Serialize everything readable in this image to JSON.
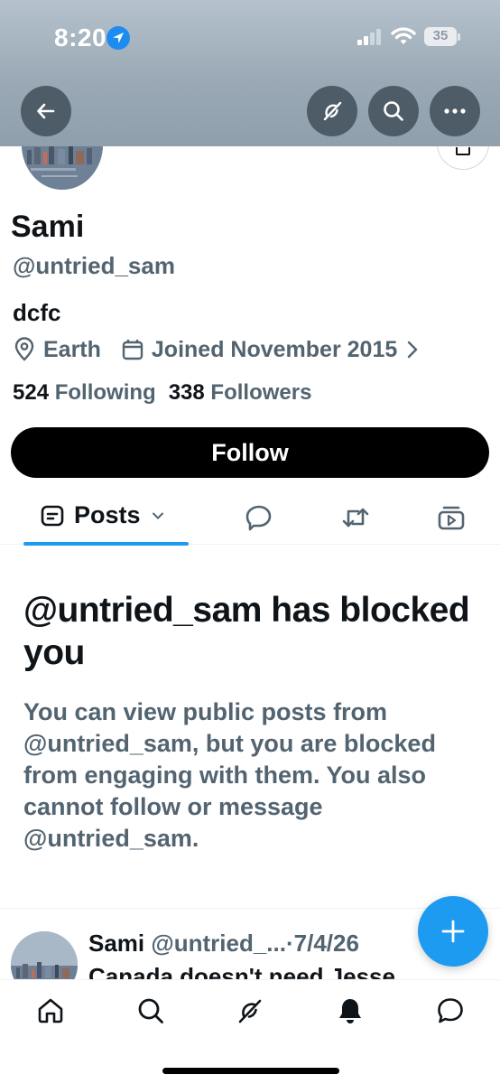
{
  "status_bar": {
    "time": "8:20",
    "battery": "35"
  },
  "header": {
    "back_icon": "arrow-left-icon",
    "grok_icon": "grok-icon",
    "search_icon": "search-icon",
    "more_icon": "more-horizontal-icon"
  },
  "profile": {
    "name": "Sami",
    "handle": "@untried_sam",
    "bio": "dcfc",
    "location": "Earth",
    "joined": "Joined November 2015",
    "following_count": "524",
    "following_label": "Following",
    "followers_count": "338",
    "followers_label": "Followers",
    "follow_label": "Follow"
  },
  "tabs": {
    "posts_label": "Posts",
    "reply_icon": "reply-icon",
    "retweet_icon": "retweet-icon",
    "media_icon": "media-icon"
  },
  "blocked": {
    "title": "@untried_sam has blocked you",
    "body": "You can view public posts from @untried_sam, but you are blocked from engaging with them. You also cannot follow or message @untried_sam."
  },
  "tweet": {
    "name": "Sami",
    "handle": "@untried_...",
    "separator": "·",
    "date": "7/4/26",
    "text": "Canada doesn't need Jesse"
  },
  "fab": {
    "icon": "compose-plus-icon"
  },
  "bottom_nav": {
    "items": [
      "home-icon",
      "search-icon",
      "grok-icon",
      "notifications-icon",
      "messages-icon"
    ]
  },
  "colors": {
    "accent": "#1d9bf0",
    "text_primary": "#0f1419",
    "text_secondary": "#536471",
    "header_bg": "#9aa9b5"
  }
}
